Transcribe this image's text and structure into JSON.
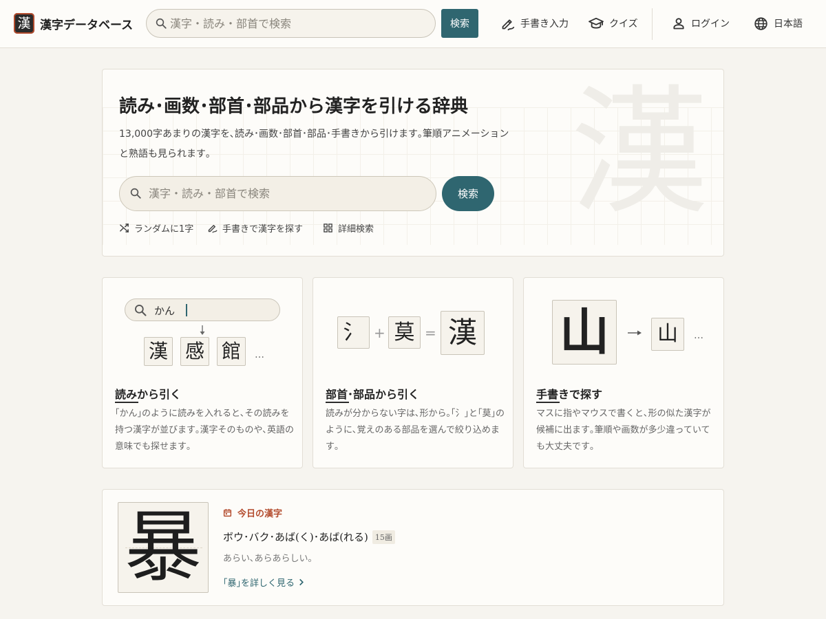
{
  "header": {
    "logo_char": "漢",
    "site_title": "漢字データベース",
    "search_placeholder": "漢字・読み・部首で検索",
    "search_button": "検索",
    "nav": {
      "handwriting": "手書き入力",
      "quiz": "クイズ",
      "login": "ログイン",
      "language": "日本語"
    }
  },
  "hero": {
    "title": "読み･画数･部首･部品から漢字を引ける辞典",
    "description": "13,000字あまりの漢字を､読み･画数･部首･部品･手書きから引けます｡筆順アニメーションと熟語も見られます｡",
    "search_placeholder": "漢字・読み・部首で検索",
    "search_button": "検索",
    "background_char": "漢",
    "links": {
      "random": "ランダムに1字",
      "handwriting": "手書きで漢字を探す",
      "advanced": "詳細検索"
    }
  },
  "features": {
    "reading": {
      "title": "読みから引く",
      "description": "｢かん｣のように読みを入れると､その読みを持つ漢字が並びます｡漢字そのものや､英語の意味でも探せます｡",
      "demo_query": "かん",
      "demo_results": [
        "漢",
        "感",
        "館"
      ],
      "ellipsis": "…"
    },
    "radical": {
      "title": "部首･部品から引く",
      "description": "読みが分からない字は､形から｡｢氵｣と｢莫｣のように､覚えのある部品を選んで絞り込めます｡",
      "part_a": "氵",
      "plus": "+",
      "part_b": "莫",
      "equals": "=",
      "result": "漢"
    },
    "handwriting": {
      "title": "手書きで探す",
      "description": "マスに指やマウスで書くと､形の似た漢字が候補に出ます｡筆順や画数が多少違っていても大丈夫です｡",
      "drawn_char": "山",
      "candidate": "山",
      "ellipsis": "…"
    }
  },
  "today": {
    "label": "今日の漢字",
    "kanji": "暴",
    "readings": "ボウ･バク･あば(く)･あば(れる)",
    "stroke_count": "15画",
    "meaning": "あらい､あらあらしい｡",
    "detail_link": "｢暴｣を詳しく見る"
  },
  "colors": {
    "accent": "#2f6670",
    "brand_red": "#b34b2d",
    "background": "#f6f4ef",
    "card": "#fdfcf9"
  }
}
